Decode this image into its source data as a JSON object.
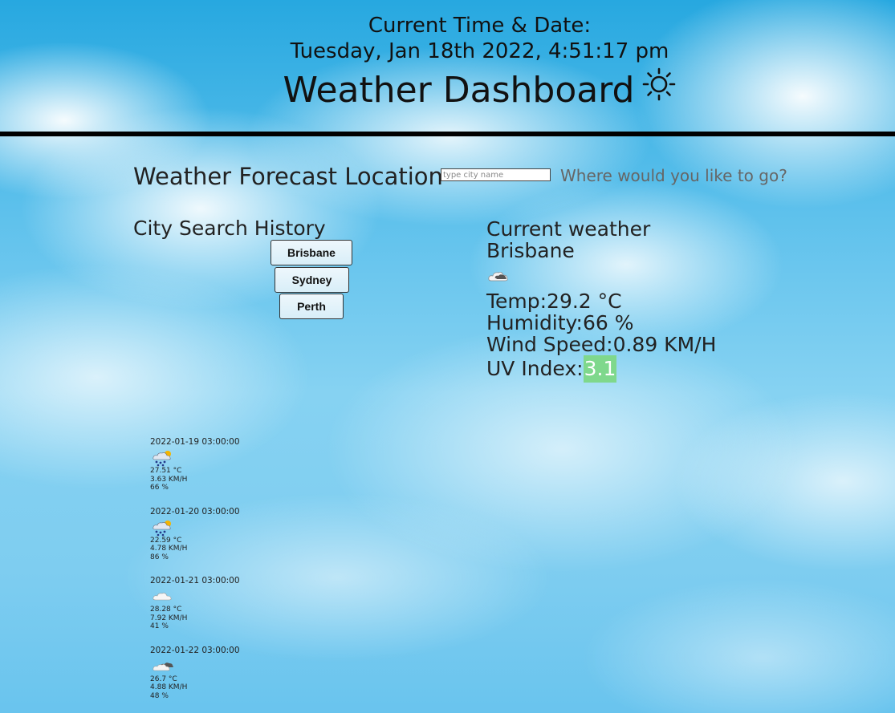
{
  "header": {
    "time_label": "Current Time & Date:",
    "time_value": "Tuesday, Jan 18th 2022, 4:51:17 pm",
    "title": "Weather Dashboard",
    "title_icon": "sun-icon"
  },
  "search": {
    "heading": "Weather Forecast Location",
    "placeholder": "type city name",
    "value": "",
    "hint": "Where would you like to go?"
  },
  "history": {
    "heading": "City Search History",
    "cities": [
      "Brisbane",
      "Sydney",
      "Perth"
    ]
  },
  "current": {
    "heading": "Current weather",
    "city": "Brisbane",
    "icon": "cloud-icon",
    "temp": "Temp:29.2 °C",
    "humidity": "Humidity:66 %",
    "wind": "Wind Speed:0.89 KM/H",
    "uv_label": "UV Index:",
    "uv_value": "3.1",
    "uv_color": "#7fd88c"
  },
  "forecast": [
    {
      "date": "2022-01-19 03:00:00",
      "icon": "rain-sun-icon",
      "temp": "27.51 °C",
      "wind": "3.63 KM/H",
      "humidity": "66 %"
    },
    {
      "date": "2022-01-20 03:00:00",
      "icon": "rain-sun-icon",
      "temp": "22.59 °C",
      "wind": "4.78 KM/H",
      "humidity": "86 %"
    },
    {
      "date": "2022-01-21 03:00:00",
      "icon": "cloud-icon",
      "temp": "28.28 °C",
      "wind": "7.92 KM/H",
      "humidity": "41 %"
    },
    {
      "date": "2022-01-22 03:00:00",
      "icon": "broken-clouds-icon",
      "temp": "26.7 °C",
      "wind": "4.88 KM/H",
      "humidity": "48 %"
    }
  ]
}
